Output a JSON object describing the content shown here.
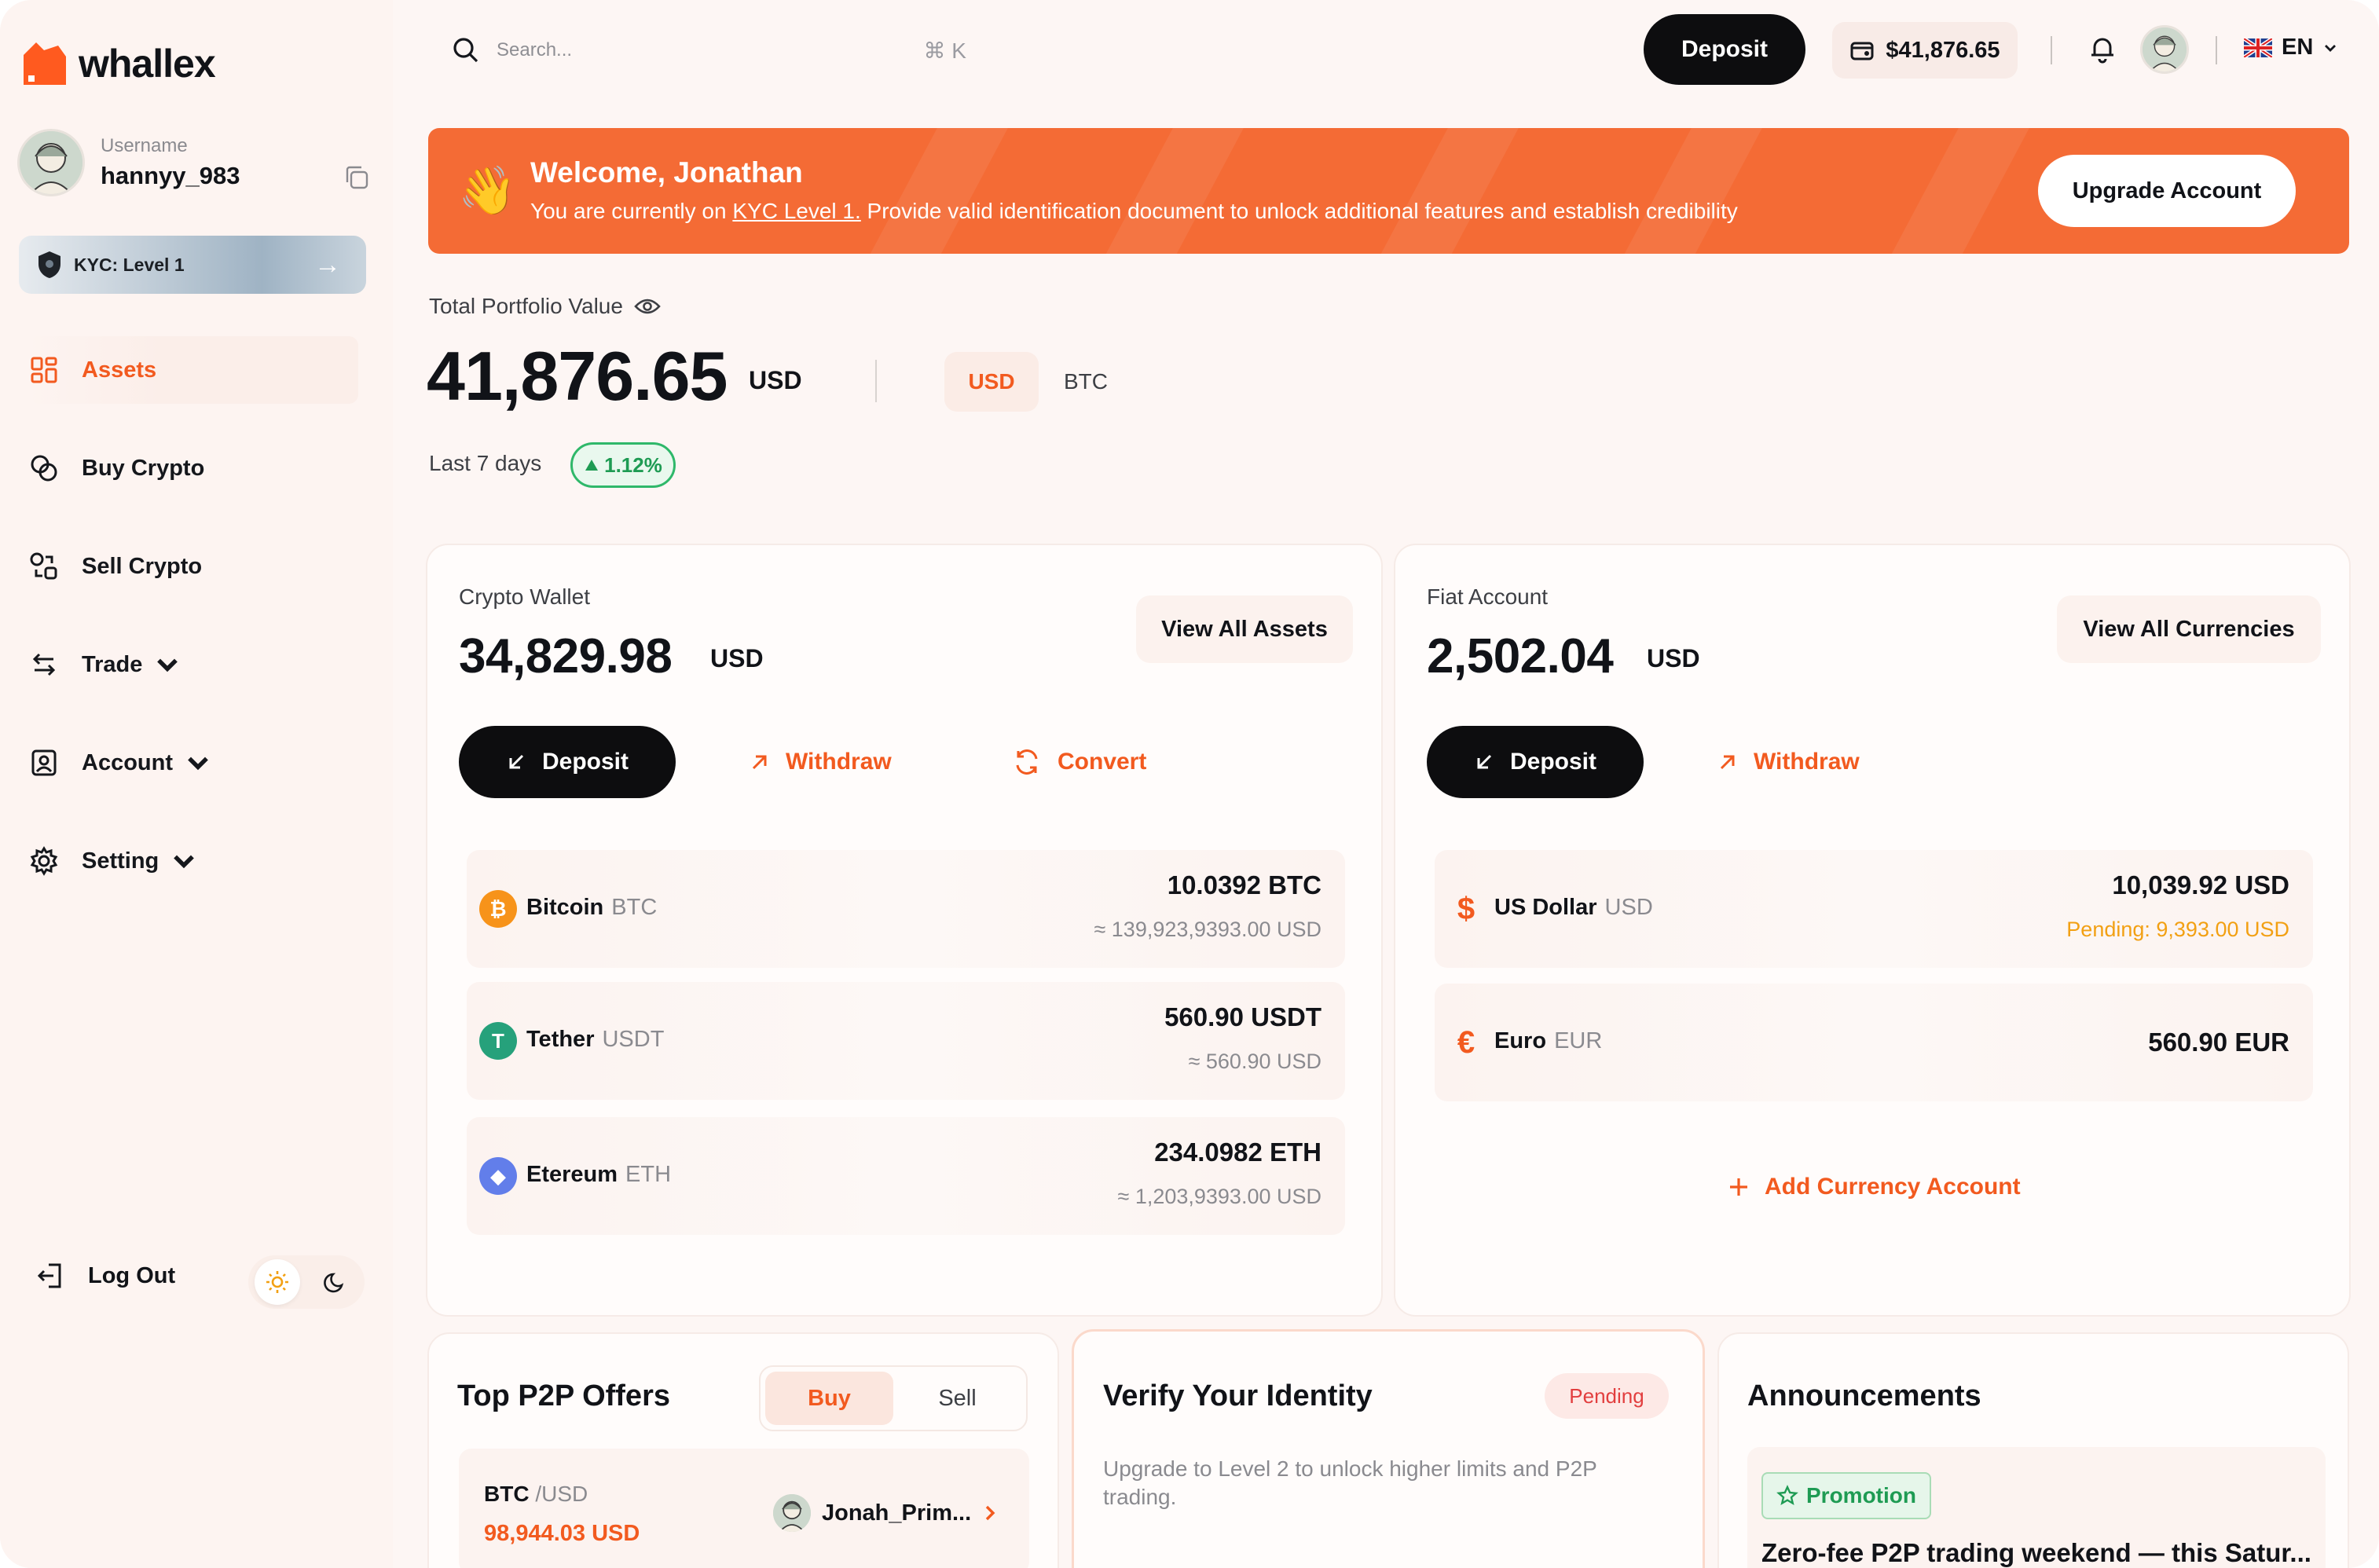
{
  "brand": {
    "name": "whallex",
    "accent": "#f25a1f"
  },
  "user": {
    "label": "Username",
    "name": "hannyy_983",
    "kyc_label": "KYC: Level 1"
  },
  "nav": [
    {
      "label": "Assets",
      "icon": "grid-icon",
      "active": true
    },
    {
      "label": "Buy Crypto",
      "icon": "coins-icon"
    },
    {
      "label": "Sell Crypto",
      "icon": "exchange-icon"
    },
    {
      "label": "Trade",
      "icon": "arrows-icon",
      "has_submenu": true
    },
    {
      "label": "Account",
      "icon": "user-square-icon",
      "has_submenu": true
    },
    {
      "label": "Setting",
      "icon": "gear-icon",
      "has_submenu": true
    }
  ],
  "logout_label": "Log Out",
  "search": {
    "placeholder": "Search...",
    "shortcut": "⌘ K"
  },
  "topbar": {
    "deposit_label": "Deposit",
    "balance": "$41,876.65",
    "language": "EN"
  },
  "banner": {
    "title": "Welcome, Jonathan",
    "text_before": "You are currently on ",
    "kyc_link": "KYC Level 1.",
    "text_after": " Provide valid identification document to unlock additional features and establish credibility",
    "button": "Upgrade Account"
  },
  "portfolio": {
    "label": "Total Portfolio Value",
    "value": "41,876.65",
    "unit": "USD",
    "currencies": [
      "USD",
      "BTC"
    ],
    "selected_currency": "USD",
    "period": "Last 7 days",
    "change": "1.12%"
  },
  "crypto_wallet": {
    "label": "Crypto Wallet",
    "value": "34,829.98",
    "unit": "USD",
    "view_all": "View All Assets",
    "deposit": "Deposit",
    "withdraw": "Withdraw",
    "convert": "Convert",
    "assets": [
      {
        "name": "Bitcoin",
        "symbol": "BTC",
        "amount": "10.0392 BTC",
        "usd": "≈ 139,923,9393.00 USD",
        "color": "#f7931a",
        "glyph": "₿"
      },
      {
        "name": "Tether",
        "symbol": "USDT",
        "amount": "560.90 USDT",
        "usd": "≈ 560.90 USD",
        "color": "#26a17b",
        "glyph": "T"
      },
      {
        "name": "Etereum",
        "symbol": "ETH",
        "amount": "234.0982 ETH",
        "usd": "≈ 1,203,9393.00 USD",
        "color": "#627eea",
        "glyph": "◆"
      }
    ]
  },
  "fiat_account": {
    "label": "Fiat Account",
    "value": "2,502.04",
    "unit": "USD",
    "view_all": "View All Currencies",
    "deposit": "Deposit",
    "withdraw": "Withdraw",
    "currencies": [
      {
        "name": "US Dollar",
        "symbol": "USD",
        "glyph": "$",
        "amount": "10,039.92 USD",
        "pending": "Pending: 9,393.00 USD"
      },
      {
        "name": "Euro",
        "symbol": "EUR",
        "glyph": "€",
        "amount": "560.90 EUR"
      }
    ],
    "add_label": "Add Currency Account"
  },
  "p2p": {
    "title": "Top P2P Offers",
    "tabs": [
      "Buy",
      "Sell"
    ],
    "active_tab": "Buy",
    "offer": {
      "base": "BTC",
      "quote": "/USD",
      "price": "98,944.03 USD",
      "user": "Jonah_Prim..."
    }
  },
  "verify": {
    "title": "Verify Your Identity",
    "status": "Pending",
    "text": "Upgrade to Level 2 to unlock higher limits and P2P trading."
  },
  "announcements": {
    "title": "Announcements",
    "badge": "Promotion",
    "headline": "Zero-fee P2P trading weekend — this Satur..."
  }
}
